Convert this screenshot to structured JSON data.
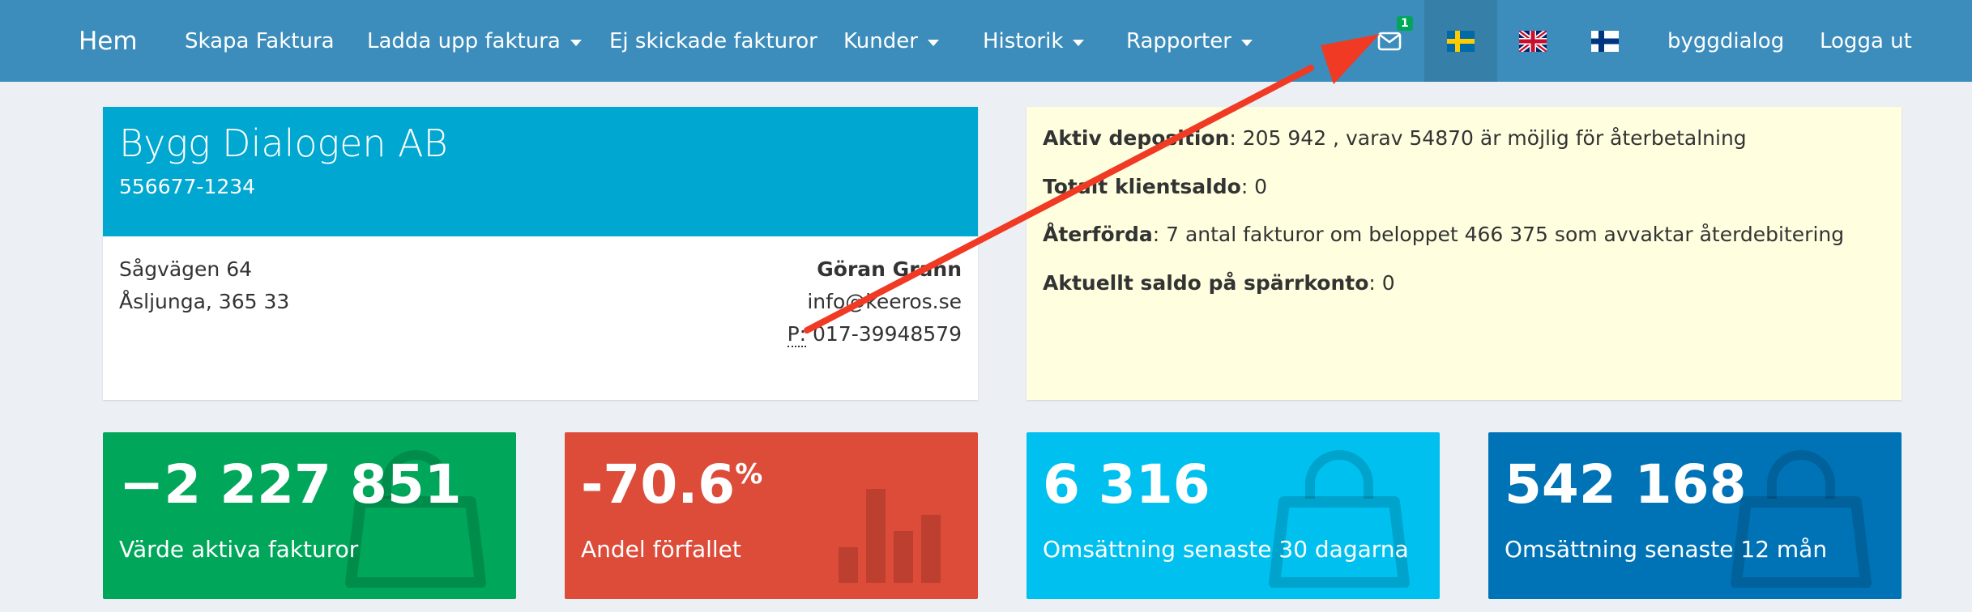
{
  "nav": {
    "brand": "Hem",
    "create_invoice": "Skapa Faktura",
    "upload_invoice": "Ladda upp faktura",
    "unsent_invoices": "Ej skickade fakturor",
    "customers": "Kunder",
    "history": "Historik",
    "reports": "Rapporter",
    "mail_badge": "1",
    "user": "byggdialog",
    "logout": "Logga ut",
    "languages": [
      "sv",
      "en",
      "fi"
    ],
    "active_language": "sv"
  },
  "company": {
    "name": "Bygg Dialogen AB",
    "org_number": "556677-1234",
    "address_street": "Sågvägen 64",
    "address_city": "Åsljunga, 365 33",
    "contact_name": "Göran Grahn",
    "contact_email": "info@keeros.se",
    "phone_label": "P:",
    "phone": "017-39948579"
  },
  "info": {
    "deposit_label": "Aktiv deposition",
    "deposit_value": ": 205 942 , varav 54870 är möjlig för återbetalning",
    "client_balance_label": "Totalt klientsaldo",
    "client_balance_value": ": 0",
    "returned_label": "Återförda",
    "returned_value": ": 7 antal fakturor om beloppet 466 375 som avvaktar återdebitering",
    "blocked_balance_label": "Aktuellt saldo på spärrkonto",
    "blocked_balance_value": ": 0"
  },
  "tiles": [
    {
      "value": "−2 227 851",
      "label": "Värde aktiva fakturor",
      "color": "#00a65a",
      "icon": "shopping-bag-icon"
    },
    {
      "value": "-70.6",
      "suffix": "%",
      "label": "Andel förfallet",
      "color": "#dd4b39",
      "icon": "bar-chart-icon"
    },
    {
      "value": "6 316",
      "label": "Omsättning senaste 30 dagarna",
      "color": "#00c0ef",
      "icon": "shopping-bag-icon"
    },
    {
      "value": "542 168",
      "label": "Omsättning senaste 12 mån",
      "color": "#0073b7",
      "icon": "shopping-bag-icon"
    }
  ],
  "colors": {
    "navbar": "#3c8dbc",
    "company_header": "#00a7d0",
    "info_box": "#ffffe0",
    "annotation_arrow": "#f03a24"
  }
}
